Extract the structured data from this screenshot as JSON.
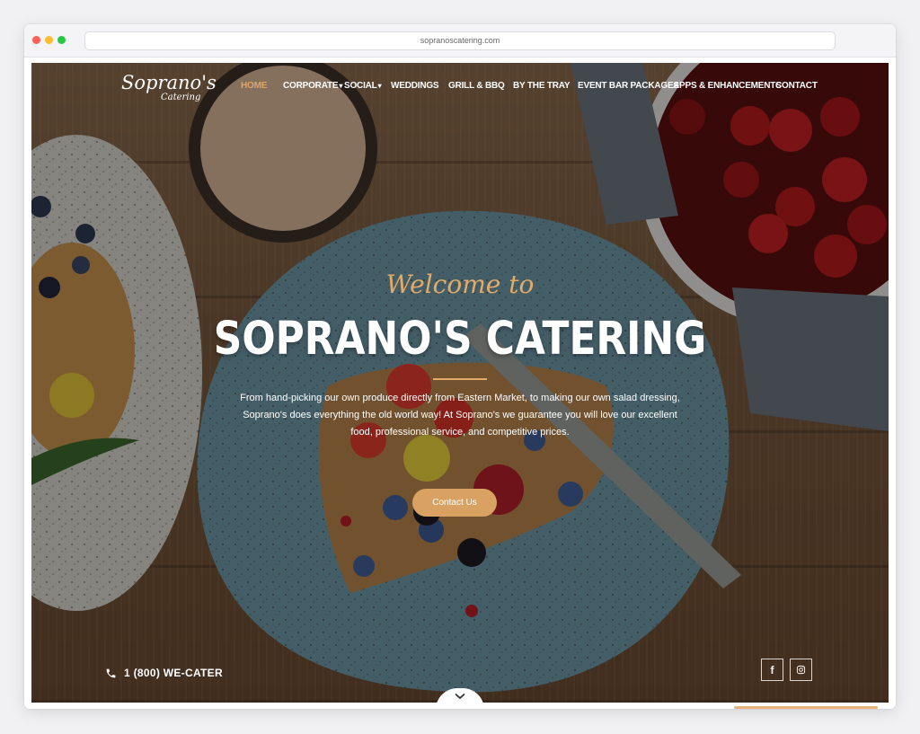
{
  "browser": {
    "url": "sopranoscatering.com"
  },
  "brand": {
    "logo_main": "Soprano's",
    "logo_sub": "Catering",
    "accent": "#e2aa68",
    "button_color": "#d9a262"
  },
  "nav": {
    "items": [
      {
        "label": "HOME",
        "active": true
      },
      {
        "label": "CORPORATE",
        "dropdown": true
      },
      {
        "label": "SOCIAL",
        "dropdown": true
      },
      {
        "label": "WEDDINGS"
      },
      {
        "label": "GRILL & BBQ"
      },
      {
        "label": "BY THE TRAY"
      },
      {
        "label": "EVENT BAR PACKAGES"
      },
      {
        "label": "APPS & ENHANCEMENTS"
      },
      {
        "label": "CONTACT"
      }
    ]
  },
  "hero": {
    "welcome": "Welcome to",
    "title": "SOPRANO'S CATERING",
    "description": "From hand-picking our own produce directly from Eastern Market, to making our own salad dressing, Soprano's does everything the old world way! At Soprano's we guarantee you will love our excellent food, professional service, and competitive prices.",
    "cta_label": "Contact Us"
  },
  "footer": {
    "phone": "1 (800) WE-CATER",
    "social": [
      {
        "name": "facebook-icon",
        "glyph": "f"
      },
      {
        "name": "instagram-icon",
        "glyph": ""
      }
    ]
  },
  "icons": {
    "phone": "phone-icon",
    "scroll": "chevron-down-icon"
  }
}
